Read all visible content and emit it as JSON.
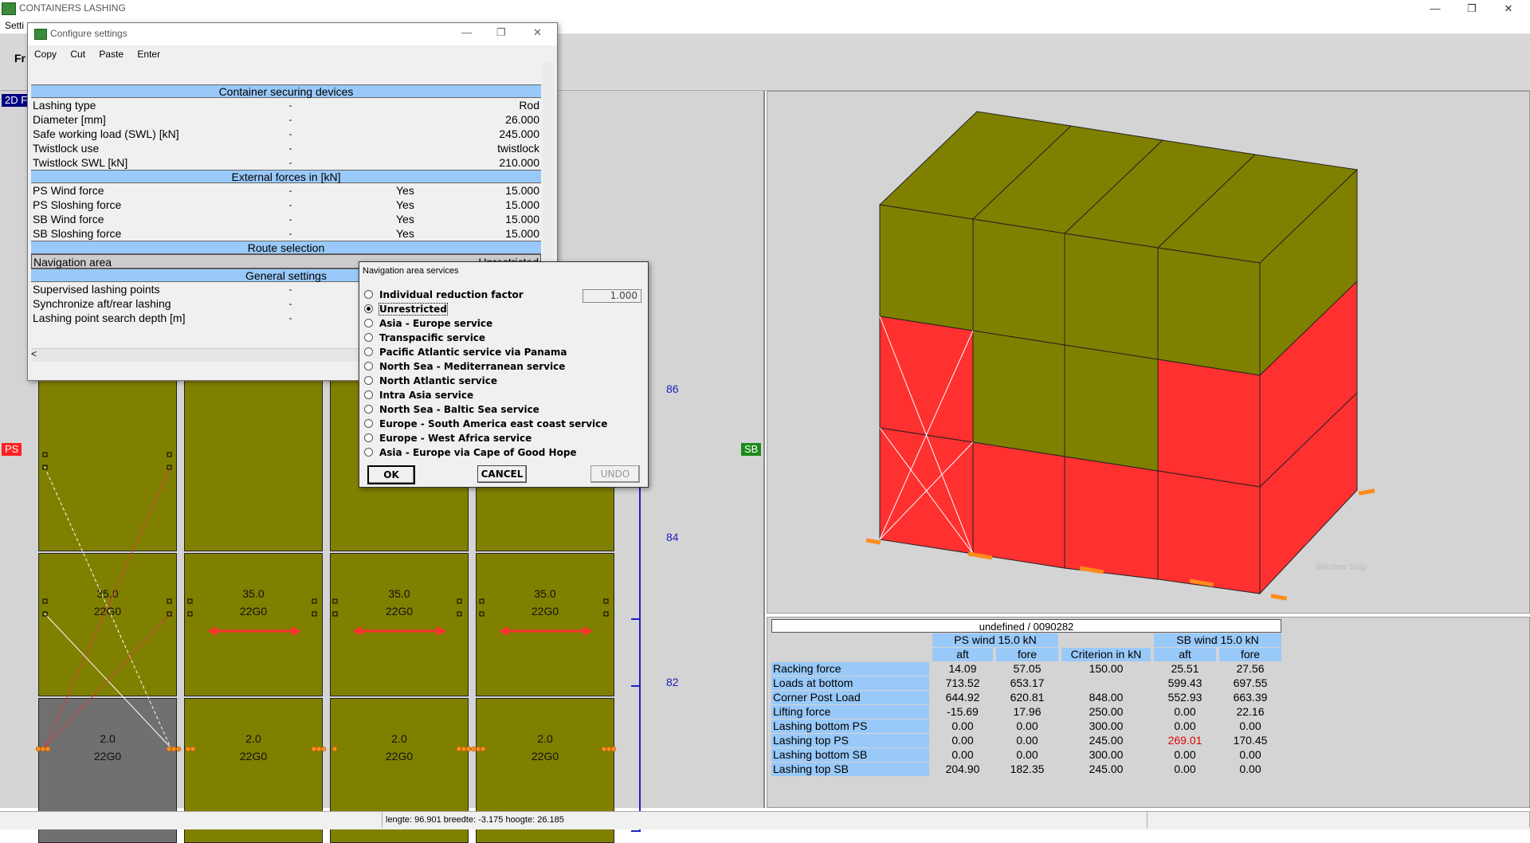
{
  "window": {
    "title": "CONTAINERS LASHING",
    "menu_settings": "Setti",
    "toolbar_label": "Fr",
    "minimize": "—",
    "maximize": "❐",
    "close": "✕"
  },
  "tags": {
    "view2d": "2D F",
    "ps": "PS",
    "sb": "SB"
  },
  "config_dialog": {
    "title": "Configure settings",
    "menu": [
      "Copy",
      "Cut",
      "Paste",
      "Enter"
    ],
    "sections": {
      "securing": "Container securing devices",
      "external": "External forces in [kN]",
      "route": "Route selection",
      "general": "General settings"
    },
    "rows": {
      "lashing_type": {
        "name": "Lashing type",
        "value": "Rod"
      },
      "diameter": {
        "name": "Diameter [mm]",
        "value": "26.000"
      },
      "swl": {
        "name": "Safe working load (SWL) [kN]",
        "value": "245.000"
      },
      "twistlock_use": {
        "name": "Twistlock use",
        "value": "twistlock"
      },
      "twistlock_swl": {
        "name": "Twistlock SWL [kN]",
        "value": "210.000"
      },
      "ps_wind": {
        "name": "PS Wind force",
        "flag": "Yes",
        "value": "15.000"
      },
      "ps_slosh": {
        "name": "PS Sloshing force",
        "flag": "Yes",
        "value": "15.000"
      },
      "sb_wind": {
        "name": "SB Wind force",
        "flag": "Yes",
        "value": "15.000"
      },
      "sb_slosh": {
        "name": "SB Sloshing force",
        "flag": "Yes",
        "value": "15.000"
      },
      "nav_area": {
        "name": "Navigation area",
        "value": "Unrestricted"
      },
      "supervised": {
        "name": "Supervised lashing points"
      },
      "sync": {
        "name": "Synchronize aft/rear lashing"
      },
      "search_depth": {
        "name": "Lashing point search depth [m]"
      }
    },
    "scroll_left": "<"
  },
  "nav_dialog": {
    "title": "Navigation area services",
    "factor_value": "1.000",
    "selected": "Unrestricted",
    "options": [
      "Individual reduction factor",
      "Unrestricted",
      "Asia - Europe service",
      "Transpacific service",
      "Pacific Atlantic service via Panama",
      "North Sea - Mediterranean service",
      "North Atlantic service",
      "Intra Asia service",
      "North Sea - Baltic Sea service",
      "Europe - South America east coast service",
      "Europe - West Africa service",
      "Asia - Europe via Cape of Good Hope"
    ],
    "buttons": {
      "ok": "OK",
      "cancel": "CANCEL",
      "undo": "UNDO"
    }
  },
  "grid2d": {
    "rows": [
      {
        "label": "86"
      },
      {
        "label": "84",
        "weight": "35.0",
        "type": "22G0"
      },
      {
        "label": "82",
        "weight": "2.0",
        "type": "22G0"
      }
    ]
  },
  "colors": {
    "olive": "#808000",
    "red": "#ff3030",
    "header_blue": "#99c9f9",
    "highlight_red": "#e00000"
  },
  "table": {
    "title": "undefined / 0090282",
    "group_ps": "PS wind 15.0 kN",
    "group_sb": "SB wind 15.0 kN",
    "criterion": "Criterion in kN",
    "aft": "aft",
    "fore": "fore",
    "rows": [
      {
        "label": "Racking force",
        "ps_aft": "14.09",
        "ps_fore": "57.05",
        "crit": "150.00",
        "sb_aft": "25.51",
        "sb_fore": "27.56"
      },
      {
        "label": "Loads at bottom",
        "ps_aft": "713.52",
        "ps_fore": "653.17",
        "crit": "",
        "sb_aft": "599.43",
        "sb_fore": "697.55"
      },
      {
        "label": "Corner Post Load",
        "ps_aft": "644.92",
        "ps_fore": "620.81",
        "crit": "848.00",
        "sb_aft": "552.93",
        "sb_fore": "663.39"
      },
      {
        "label": "Lifting force",
        "ps_aft": "-15.69",
        "ps_fore": "17.96",
        "crit": "250.00",
        "sb_aft": "0.00",
        "sb_fore": "22.16"
      },
      {
        "label": "Lashing bottom PS",
        "ps_aft": "0.00",
        "ps_fore": "0.00",
        "crit": "300.00",
        "sb_aft": "0.00",
        "sb_fore": "0.00"
      },
      {
        "label": "Lashing top PS",
        "ps_aft": "0.00",
        "ps_fore": "0.00",
        "crit": "245.00",
        "sb_aft": "269.01",
        "sb_fore": "170.45"
      },
      {
        "label": "Lashing bottom SB",
        "ps_aft": "0.00",
        "ps_fore": "0.00",
        "crit": "300.00",
        "sb_aft": "0.00",
        "sb_fore": "0.00"
      },
      {
        "label": "Lashing top SB",
        "ps_aft": "204.90",
        "ps_fore": "182.35",
        "crit": "245.00",
        "sb_aft": "0.00",
        "sb_fore": "0.00"
      }
    ]
  },
  "status": {
    "coords": "lengte: 96.901 breedte: -3.175 hoogte: 26.185"
  },
  "watermark": "Window Snip"
}
